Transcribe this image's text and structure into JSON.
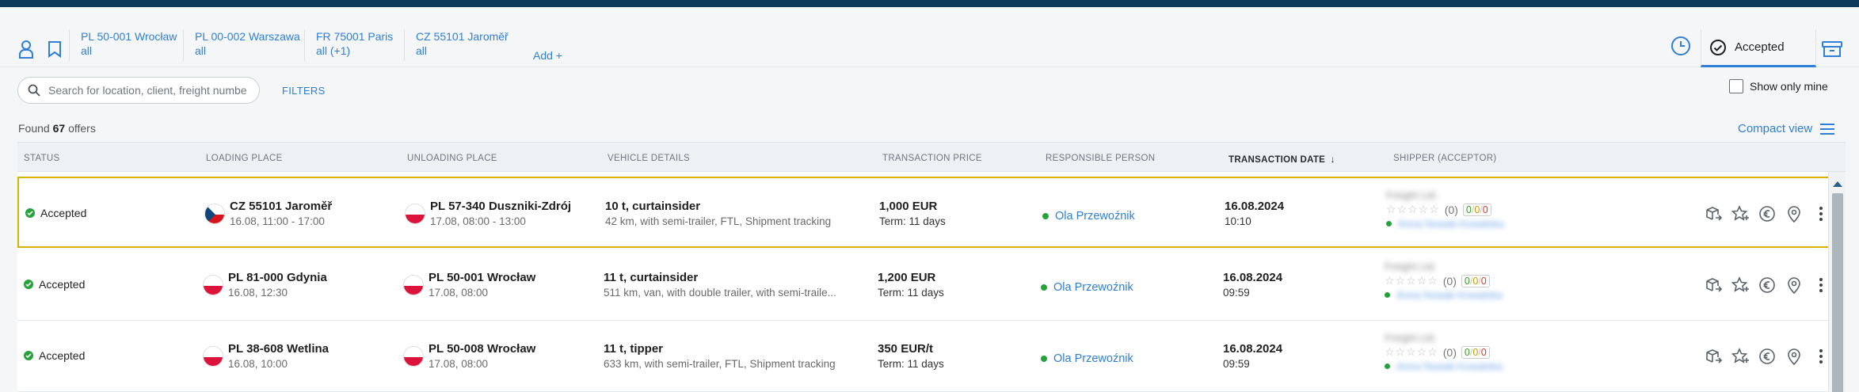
{
  "saved_searches": [
    {
      "location": "PL 50-001 Wrocław",
      "scope": "all"
    },
    {
      "location": "PL 00-002 Warszawa",
      "scope": "all"
    },
    {
      "location": "FR 75001 Paris",
      "scope": "all (+1)"
    },
    {
      "location": "CZ 55101 Jaroměř",
      "scope": "all"
    }
  ],
  "add_label": "Add +",
  "tabs": {
    "active": "Accepted"
  },
  "search": {
    "placeholder": "Search for location, client, freight number"
  },
  "filters_label": "FILTERS",
  "show_only_mine": {
    "label": "Show only mine",
    "checked": false
  },
  "found": {
    "prefix": "Found",
    "count": "67",
    "suffix": "offers"
  },
  "compact_view_label": "Compact view",
  "columns": {
    "status": "STATUS",
    "loading": "LOADING PLACE",
    "unloading": "UNLOADING PLACE",
    "vehicle": "VEHICLE DETAILS",
    "price": "TRANSACTION PRICE",
    "person": "RESPONSIBLE PERSON",
    "date": "TRANSACTION DATE",
    "shipper": "SHIPPER (ACCEPTOR)"
  },
  "rows": [
    {
      "status": "Accepted",
      "load_flag": "CZ",
      "load_place": "CZ 55101 Jaroměř",
      "load_time": "16.08, 11:00 - 17:00",
      "unload_flag": "PL",
      "unload_place": "PL 57-340 Duszniki-Zdrój",
      "unload_time": "17.08, 08:00 - 13:00",
      "vehicle": "10 t, curtainsider",
      "vehicle_details": "42 km, with semi-trailer, FTL, Shipment tracking",
      "price": "1,000 EUR",
      "term": "Term: 11 days",
      "person": "Ola Przewoźnik",
      "date": "16.08.2024",
      "time": "10:10",
      "shipper_name": "Freight Ltd.",
      "rating_count": "(0)",
      "score_g": "0",
      "score_y": "0",
      "score_r": "0",
      "acceptor": "Anna Nowak-Kowalska"
    },
    {
      "status": "Accepted",
      "load_flag": "PL",
      "load_place": "PL 81-000 Gdynia",
      "load_time": "16.08, 12:30",
      "unload_flag": "PL",
      "unload_place": "PL 50-001 Wrocław",
      "unload_time": "17.08, 08:00",
      "vehicle": "11 t, curtainsider",
      "vehicle_details": "511 km, van, with double trailer, with semi-traile...",
      "price": "1,200 EUR",
      "term": "Term: 11 days",
      "person": "Ola Przewoźnik",
      "date": "16.08.2024",
      "time": "09:59",
      "shipper_name": "Freight Ltd.",
      "rating_count": "(0)",
      "score_g": "0",
      "score_y": "0",
      "score_r": "0",
      "acceptor": "Anna Nowak-Kowalska"
    },
    {
      "status": "Accepted",
      "load_flag": "PL",
      "load_place": "PL 38-608 Wetlina",
      "load_time": "16.08, 10:00",
      "unload_flag": "PL",
      "unload_place": "PL 50-008 Wrocław",
      "unload_time": "17.08, 08:00",
      "vehicle": "11 t, tipper",
      "vehicle_details": "633 km, with semi-trailer, FTL, Shipment tracking",
      "price": "350 EUR/t",
      "term": "Term: 11 days",
      "person": "Ola Przewoźnik",
      "date": "16.08.2024",
      "time": "09:59",
      "shipper_name": "Freight Ltd.",
      "rating_count": "(0)",
      "score_g": "0",
      "score_y": "0",
      "score_r": "0",
      "acceptor": "Anna Nowak-Kowalska"
    }
  ],
  "colors": {
    "accent": "#2f7fd6",
    "selected_border": "#d9b200",
    "status_green": "#26a23a"
  }
}
